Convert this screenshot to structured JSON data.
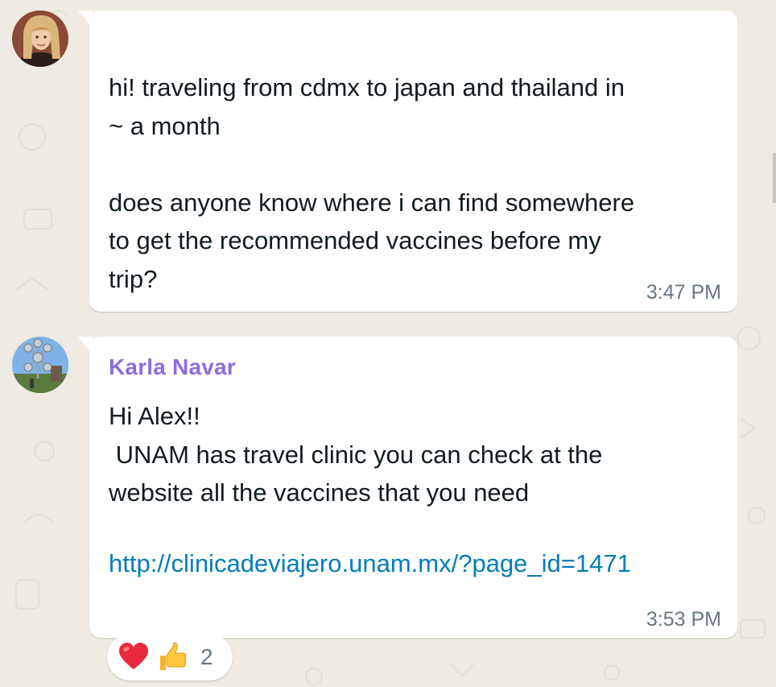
{
  "messages": [
    {
      "author": "",
      "text": "hi! traveling from cdmx to japan and thailand in\n~ a month\n\ndoes anyone know where i can find somewhere\nto get the recommended vaccines before my\ntrip?",
      "time": "3:47 PM",
      "avatar": "user-avatar-photo"
    },
    {
      "author": "Karla Navar",
      "text": "Hi Alex!!\n UNAM has travel clinic you can check at the\nwebsite all the vaccines that you need",
      "link": "http://clinicadeviajero.unam.mx/?page_id=1471",
      "time": "3:53 PM",
      "avatar": "sender-avatar-photo",
      "reactions": {
        "emojis": [
          "heart",
          "thumbs-up"
        ],
        "count": "2"
      }
    }
  ],
  "colors": {
    "background": "#efeae2",
    "bubble": "#ffffff",
    "sender_name": "#8e6cd9",
    "link": "#027eb5",
    "timestamp": "#667781",
    "text": "#111b21"
  }
}
